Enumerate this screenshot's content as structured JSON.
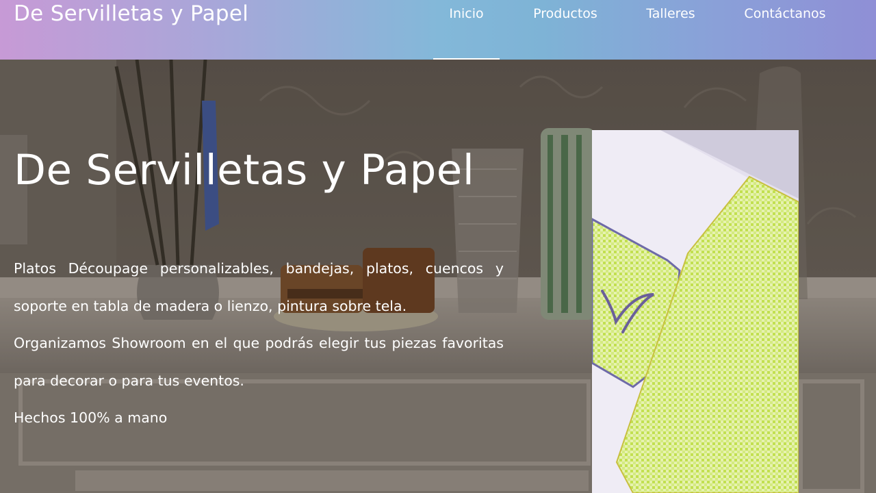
{
  "navbar": {
    "brand": "De Servilletas y Papel",
    "links": [
      {
        "label": "Inicio",
        "active": true
      },
      {
        "label": "Productos",
        "active": false
      },
      {
        "label": "Talleres",
        "active": false
      },
      {
        "label": "Contáctanos",
        "active": false
      }
    ]
  },
  "hero": {
    "title": "De Servilletas y Papel",
    "paragraph_1": "Platos Découpage personalizables, bandejas, platos, cuencos y soporte en tabla de madera o lienzo, pintura sobre tela.",
    "paragraph_2": "Organizamos Showroom en el que podrás elegir tus piezas favoritas para decorar o para tus eventos.",
    "paragraph_3": "Hechos 100% a mano"
  },
  "colors": {
    "navbar_gradient_start": "#c79ad6",
    "navbar_gradient_mid": "#7eb3d6",
    "navbar_gradient_end": "#8f8fd6",
    "text": "#ffffff",
    "napkin_check": "#c8e85a"
  }
}
